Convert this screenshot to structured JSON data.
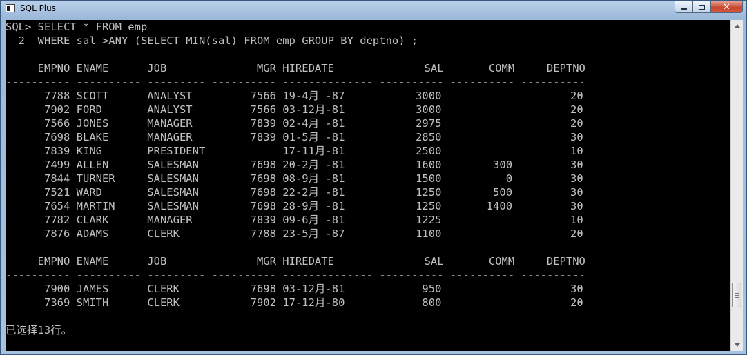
{
  "window": {
    "title": "SQL Plus"
  },
  "controls": {
    "minimize_icon": "minimize-icon",
    "maximize_icon": "maximize-icon",
    "close_icon": "close-icon",
    "close_glyph": "✕"
  },
  "console": {
    "lines": [
      "SQL> SELECT * FROM emp",
      "  2  WHERE sal >ANY (SELECT MIN(sal) FROM emp GROUP BY deptno) ;",
      "",
      "     EMPNO ENAME      JOB              MGR HIREDATE              SAL       COMM     DEPTNO",
      "---------- ---------- --------- ---------- -------------- ---------- ---------- ----------",
      "      7788 SCOTT      ANALYST         7566 19-4月 -87           3000                    20",
      "      7902 FORD       ANALYST         7566 03-12月-81           3000                    20",
      "      7566 JONES      MANAGER         7839 02-4月 -81           2975                    20",
      "      7698 BLAKE      MANAGER         7839 01-5月 -81           2850                    30",
      "      7839 KING       PRESIDENT            17-11月-81           2500                    10",
      "      7499 ALLEN      SALESMAN        7698 20-2月 -81           1600        300         30",
      "      7844 TURNER     SALESMAN        7698 08-9月 -81           1500          0         30",
      "      7521 WARD       SALESMAN        7698 22-2月 -81           1250        500         30",
      "      7654 MARTIN     SALESMAN        7698 28-9月 -81           1250       1400         30",
      "      7782 CLARK      MANAGER         7839 09-6月 -81           1225                    10",
      "      7876 ADAMS      CLERK           7788 23-5月 -87           1100                    20",
      "",
      "     EMPNO ENAME      JOB              MGR HIREDATE              SAL       COMM     DEPTNO",
      "---------- ---------- --------- ---------- -------------- ---------- ---------- ----------",
      "      7900 JAMES      CLERK           7698 03-12月-81            950                    30",
      "      7369 SMITH      CLERK           7902 17-12月-80            800                    20",
      "",
      "已选择13行。"
    ]
  }
}
